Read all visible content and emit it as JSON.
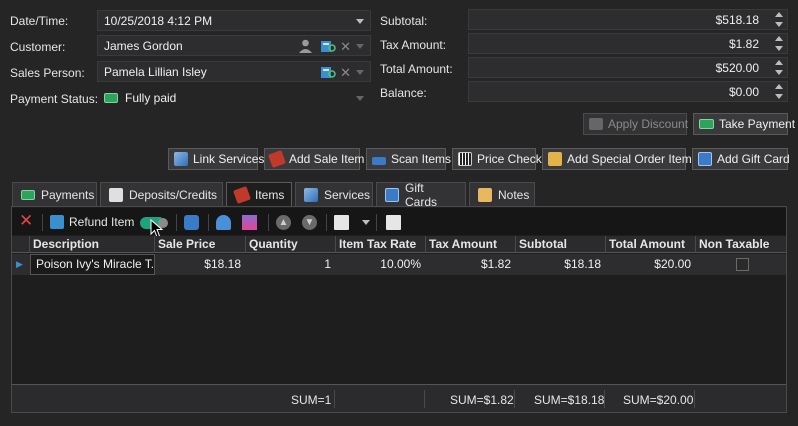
{
  "form": {
    "datetime_label": "Date/Time:",
    "datetime_value": "10/25/2018 4:12 PM",
    "customer_label": "Customer:",
    "customer_value": "James Gordon",
    "salesperson_label": "Sales Person:",
    "salesperson_value": "Pamela Lillian Isley",
    "payment_status_label": "Payment Status:",
    "payment_status_value": "Fully paid"
  },
  "totals": {
    "subtotal_label": "Subtotal:",
    "subtotal_value": "$518.18",
    "tax_label": "Tax Amount:",
    "tax_value": "$1.82",
    "total_label": "Total Amount:",
    "total_value": "$520.00",
    "balance_label": "Balance:",
    "balance_value": "$0.00"
  },
  "actions": {
    "apply_discount": "Apply Discount",
    "take_payment": "Take Payment",
    "link_services": "Link Services",
    "add_sale_item": "Add Sale Item",
    "scan_items": "Scan Items",
    "price_check": "Price Check",
    "add_special_order_item": "Add Special Order Item",
    "add_gift_card": "Add Gift Card"
  },
  "tabs": [
    {
      "label": "Payments"
    },
    {
      "label": "Deposits/Credits"
    },
    {
      "label": "Items"
    },
    {
      "label": "Services"
    },
    {
      "label": "Gift Cards"
    },
    {
      "label": "Notes"
    }
  ],
  "toolbar": {
    "refund_item": "Refund Item"
  },
  "grid": {
    "columns": [
      "Description",
      "Sale Price",
      "Quantity",
      "Item Tax Rate",
      "Tax Amount",
      "Subtotal",
      "Total Amount",
      "Non Taxable"
    ],
    "rows": [
      {
        "description": "Poison Ivy's Miracle T...",
        "sale_price": "$18.18",
        "quantity": "1",
        "item_tax_rate": "10.00%",
        "tax_amount": "$1.82",
        "subtotal": "$18.18",
        "total_amount": "$20.00",
        "non_taxable": false
      }
    ],
    "footer": {
      "quantity_sum": "SUM=1",
      "tax_sum": "SUM=$1.82",
      "subtotal_sum": "SUM=$18.18",
      "total_sum": "SUM=$20.00"
    }
  },
  "colors": {
    "background": "#252526",
    "panel": "#1e1e1e",
    "accent_blue": "#2f8fd8",
    "money_green": "#3bb36a",
    "delete_red": "#e04646"
  },
  "icons": [
    "user-icon",
    "lookup-icon",
    "clear-icon",
    "money-icon",
    "wrench-icon",
    "tag-icon",
    "scanner-icon",
    "barcode-icon",
    "special-order-icon",
    "gift-icon",
    "note-icon",
    "delete-icon",
    "refund-icon",
    "pointer-icon"
  ]
}
